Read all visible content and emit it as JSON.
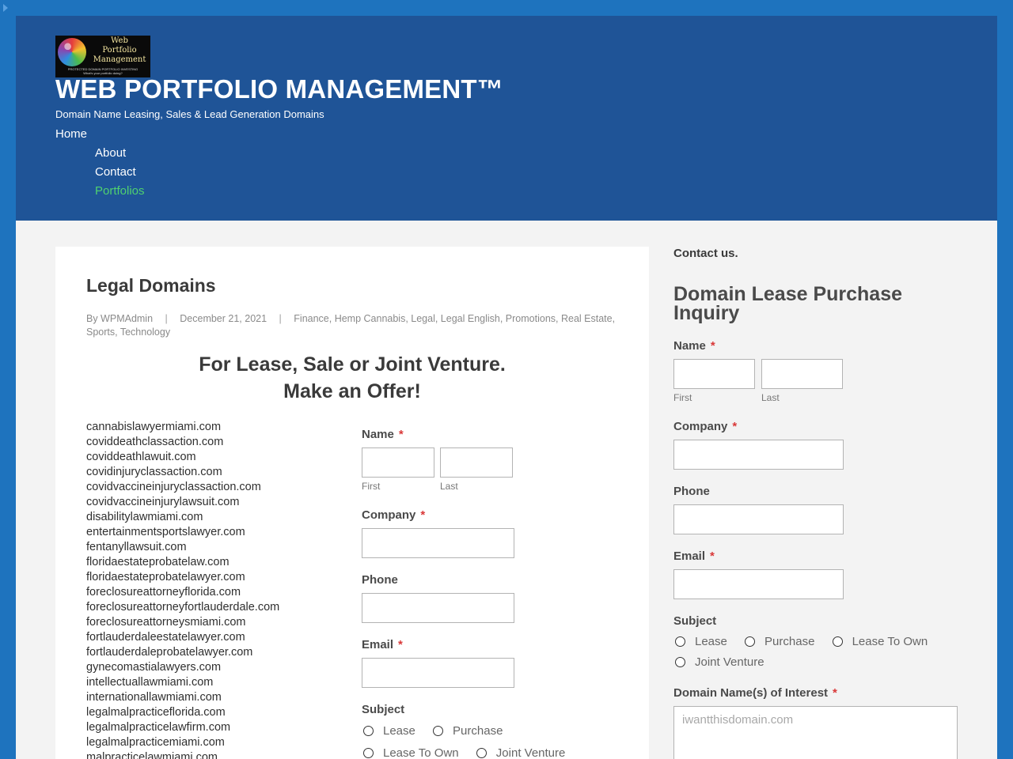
{
  "header": {
    "logo": {
      "text_lines": [
        "Web",
        "Portfolio",
        "Management"
      ],
      "tagline": "PROTECTED DOMAIN PORTFOLIO INVESTING",
      "tagline2": "What's your portfolio doing?"
    },
    "site_title": "WEB PORTFOLIO MANAGEMENT™",
    "tagline": "Domain Name Leasing, Sales & Lead Generation Domains",
    "nav": {
      "home": "Home",
      "about": "About",
      "contact": "Contact",
      "portfolios": "Portfolios",
      "active_color": "#4fd16f"
    }
  },
  "colors": {
    "page_bg": "#1e73be",
    "header_bg": "#1f5497",
    "required": "#d93838"
  },
  "article": {
    "title": "Legal Domains",
    "meta": {
      "author": "By WPMAdmin",
      "date": "December 21, 2021",
      "categories": "Finance, Hemp Cannabis, Legal, Legal English, Promotions, Real Estate, Sports, Technology"
    },
    "headline_line1": "For Lease, Sale or Joint Venture.",
    "headline_line2": "Make an Offer!",
    "domains": [
      "cannabislawyermiami.com",
      "coviddeathclassaction.com",
      "coviddeathlawuit.com",
      "covidinjuryclassaction.com",
      "covidvaccineinjuryclassaction.com",
      "covidvaccineinjurylawsuit.com",
      "disabilitylawmiami.com",
      "entertainmentsportslawyer.com",
      "fentanyllawsuit.com",
      "floridaestateprobatelaw.com",
      "floridaestateprobatelawyer.com",
      "foreclosureattorneyflorida.com",
      "foreclosureattorneyfortlauderdale.com",
      "foreclosureattorneysmiami.com",
      "fortlauderdaleestatelawyer.com",
      "fortlauderdaleprobatelawyer.com",
      "gynecomastialawyers.com",
      "intellectuallawmiami.com",
      "internationallawmiami.com",
      "legalmalpracticeflorida.com",
      "legalmalpracticelawfirm.com",
      "legalmalpracticemiami.com",
      "malpracticelawmiami.com"
    ],
    "form": {
      "name_label": "Name",
      "required_mark": "*",
      "first_label": "First",
      "last_label": "Last",
      "company_label": "Company",
      "phone_label": "Phone",
      "email_label": "Email",
      "subject_label": "Subject",
      "subject_options": [
        "Lease",
        "Purchase",
        "Lease To Own",
        "Joint Venture"
      ]
    }
  },
  "sidebar": {
    "widget_title": "Contact us.",
    "heading": "Domain Lease Purchase Inquiry",
    "form": {
      "name_label": "Name",
      "required_mark": "*",
      "first_label": "First",
      "last_label": "Last",
      "company_label": "Company",
      "phone_label": "Phone",
      "email_label": "Email",
      "subject_label": "Subject",
      "subject_options": [
        "Lease",
        "Purchase",
        "Lease To Own",
        "Joint Venture"
      ],
      "domain_interest_label": "Domain Name(s) of Interest",
      "domain_interest_placeholder": "iwantthisdomain.com"
    }
  }
}
